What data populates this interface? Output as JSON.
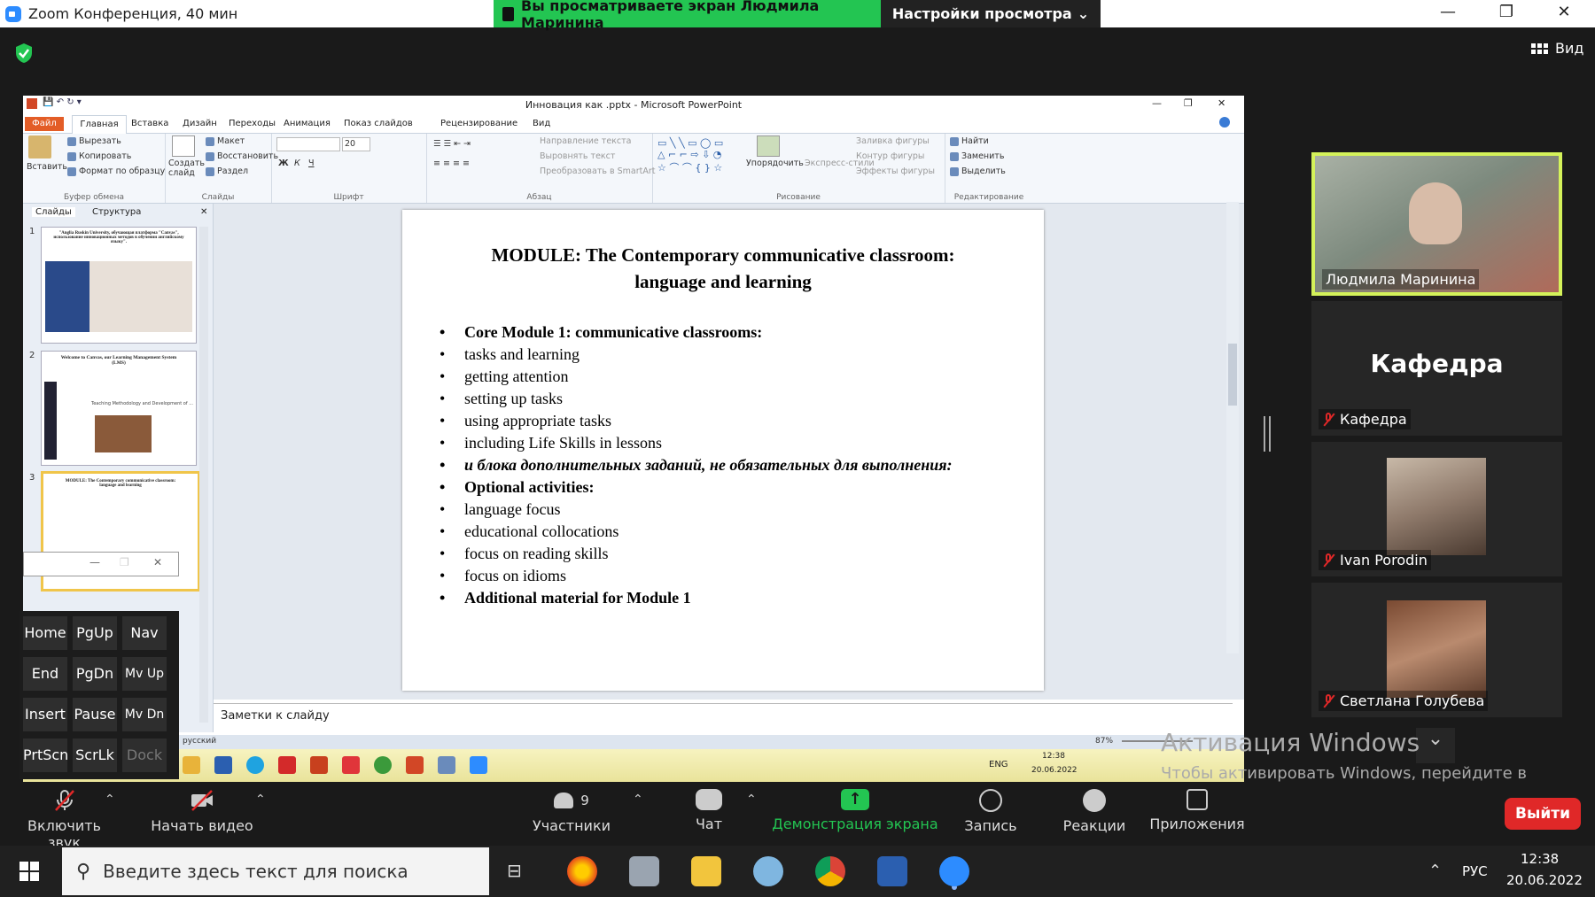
{
  "zoom": {
    "title": "Zoom Конференция, 40 мин",
    "banner": "Вы просматриваете экран Людмила Маринина",
    "view_options": "Настройки просмотра",
    "view_button": "Вид"
  },
  "ppt": {
    "window_title": "Инновация как .pptx - Microsoft PowerPoint",
    "tabs": [
      "Файл",
      "Главная",
      "Вставка",
      "Дизайн",
      "Переходы",
      "Анимация",
      "Показ слайдов",
      "Рецензирование",
      "Вид"
    ],
    "ribbon": {
      "paste": "Вставить",
      "cut": "Вырезать",
      "copy": "Копировать",
      "format": "Формат по образцу",
      "clipboard": "Буфер обмена",
      "create": "Создать слайд",
      "layout": "Макет",
      "restore": "Восстановить",
      "section": "Раздел",
      "slides": "Слайды",
      "font_size": "20",
      "font": "Шрифт",
      "paragraph": "Абзац",
      "text_dir": "Направление текста",
      "align_text": "Выровнять текст",
      "smartart": "Преобразовать в SmartArt",
      "arrange": "Упорядочить",
      "quick_styles": "Экспресс-стили",
      "drawing": "Рисование",
      "fill": "Заливка фигуры",
      "outline": "Контур фигуры",
      "effects": "Эффекты фигуры",
      "find": "Найти",
      "replace": "Заменить",
      "select": "Выделить",
      "editing": "Редактирование"
    },
    "panel_tabs": [
      "Слайды",
      "Структура"
    ],
    "thumb_nums": [
      "1",
      "2",
      "3"
    ],
    "thumb1_title": "\"Anglia Ruskin University, обучающая платформа \"Canvas\", использование инновационных методов в обучении английскому языку\".",
    "thumb2_title": "Welcome to Canvas, our Learning Management System (LMS)",
    "thumb2_sub": "Teaching Methodology and Development of ...",
    "thumb3_title": "MODULE: The Contemporary communicative classroom: language and learning",
    "slide": {
      "title_line1": "MODULE: The Contemporary communicative classroom:",
      "title_line2": "language and learning",
      "bullets": [
        "Core Module 1: communicative classrooms:",
        "tasks and learning",
        "getting attention",
        "setting up tasks",
        "using appropriate tasks",
        " including Life Skills in lessons",
        "и блока дополнительных заданий, не обязательных для выполнения:",
        "Optional activities:",
        "language focus",
        "educational collocations",
        "focus on reading skills",
        "focus on idioms",
        "Additional material for Module 1"
      ]
    },
    "notes": "Заметки к слайду",
    "status_lang": "русский",
    "zoom_level": "87%"
  },
  "remote_taskbar": {
    "lang": "ENG",
    "time": "12:38",
    "date": "20.06.2022"
  },
  "osk": {
    "keys": [
      "Home",
      "PgUp",
      "Nav",
      "End",
      "PgDn",
      "Mv Up",
      "Insert",
      "Pause",
      "Mv Dn",
      "PrtScn",
      "ScrLk",
      "Dock"
    ]
  },
  "participants": [
    {
      "name": "Людмила Маринина"
    },
    {
      "name": "Кафедра",
      "big": "Кафедра"
    },
    {
      "name": "Ivan Porodin"
    },
    {
      "name": "Светлана Голубева"
    }
  ],
  "activation": {
    "title": "Активация Windows",
    "text": "Чтобы активировать Windows, перейдите в раздел \"Параметры\"."
  },
  "toolbar": {
    "unmute": "Включить звук",
    "start_video": "Начать видео",
    "participants": "Участники",
    "participants_count": "9",
    "chat": "Чат",
    "share": "Демонстрация экрана",
    "record": "Запись",
    "reactions": "Реакции",
    "apps": "Приложения",
    "leave": "Выйти"
  },
  "taskbar": {
    "search_placeholder": "Введите здесь текст для поиска",
    "lang": "РУС",
    "time": "12:38",
    "date": "20.06.2022"
  },
  "colors": {
    "zoom_green": "#23c552",
    "leave_red": "#e02828",
    "active_speaker": "#d4f25a",
    "ppt_orange": "#e35d27"
  }
}
